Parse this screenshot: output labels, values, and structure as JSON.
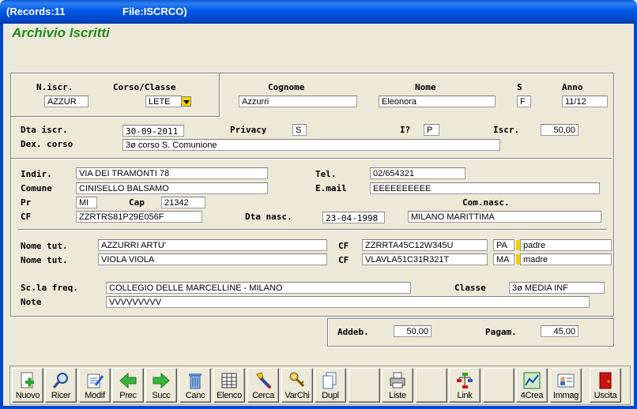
{
  "titlebar": {
    "records": "(Records:11",
    "file": "File:ISCRCO)"
  },
  "app_title": "Archivio Iscritti",
  "labels": {
    "niscr": "N.iscr.",
    "corso": "Corso/Classe",
    "cognome": "Cognome",
    "nome": "Nome",
    "s": "S",
    "anno": "Anno",
    "dta_iscr": "Dta iscr.",
    "privacy": "Privacy",
    "i": "I?",
    "iscr": "Iscr.",
    "dex": "Dex. corso",
    "indir": "Indir.",
    "tel": "Tel.",
    "comune": "Comune",
    "email": "E.mail",
    "pr": "Pr",
    "cap": "Cap",
    "comnasc": "Com.nasc.",
    "cf": "CF",
    "dtanasc": "Dta nasc.",
    "nometut": "Nome tut.",
    "cf_tut": "CF",
    "scla": "Sc.la freq.",
    "classe": "Classe",
    "note": "Note",
    "addeb": "Addeb.",
    "pagam": "Pagam."
  },
  "fields": {
    "niscr": "AZZUR",
    "corso": "LETE",
    "cognome": "Azzurri",
    "nome": "Eleonora",
    "sesso": "F",
    "anno": "11/12",
    "dta_iscr": "30-09-2011",
    "privacy": "S",
    "i": "P",
    "iscr": "50,00",
    "dex": "3ø corso S. Comunione",
    "indir": "VIA DEI TRAMONTI 78",
    "tel": "02/654321",
    "comune": "CINISELLO BALSAMO",
    "email": "EEEEEEEEEE",
    "pr": "MI",
    "cap": "21342",
    "comnasc": "MILANO MARITTIMA",
    "cf": "ZZRTRS81P29E056F",
    "dtanasc": "23-04-1998",
    "tut1": "AZZURRI ARTU'",
    "cf_tut1": "ZZRRTA45C12W345U",
    "pr_tut1": "PA",
    "rel_tut1": "padre",
    "tut2": "VIOLA VIOLA",
    "cf_tut2": "VLAVLA51C31R321T",
    "pr_tut2": "MA",
    "rel_tut2": "madre",
    "scla": "COLLEGIO DELLE MARCELLINE - MILANO",
    "classe": "3ø MEDIA INF",
    "note": "VVVVVVVVV",
    "addeb": "50,00",
    "pagam": "45,00"
  },
  "toolbar": {
    "nuovo": "Nuovo",
    "ricer": "Ricer",
    "modif": "Modif",
    "prec": "Prec",
    "succ": "Succ",
    "canc": "Canc",
    "elenco": "Elenco",
    "cerca": "Cerca",
    "varchi": "VarChi",
    "dupl": "Dupl",
    "liste": "Liste",
    "link": "Link",
    "crea": "4Crea",
    "immag": "Immag",
    "uscita": "Uscita"
  },
  "colors": {
    "title_green": "#1f8a1f",
    "titlebar_blue": "#0058e6",
    "marker_yellow": "#f4d000",
    "exit_red": "#c81414"
  }
}
